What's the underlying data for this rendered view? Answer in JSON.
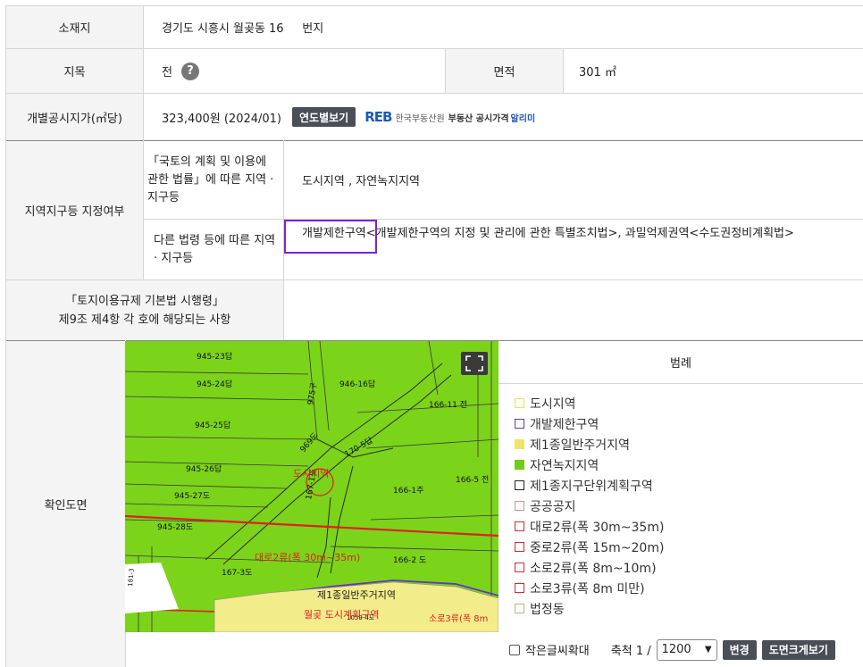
{
  "row_address": {
    "label": "소재지",
    "value": "경기도 시흥시 월곶동 16     번지"
  },
  "row_land": {
    "label": "지목",
    "value": "전",
    "area_label": "면적",
    "area_value": "301 ㎡"
  },
  "row_price": {
    "label": "개별공시지가(㎡당)",
    "value": "323,400원 (2024/01)",
    "button": "연도별보기",
    "reb_logo": "REB",
    "reb_name": "한국부동산원",
    "reb_service": "부동산 공시가격",
    "reb_alimi": "알리미"
  },
  "zone": {
    "label": "지역지구등 지정여부",
    "law1_label": "「국토의 계획 및 이용에 관한 법률」에 따른 지역 · 지구등",
    "law1_value": "도시지역 , 자연녹지지역",
    "law2_label": "다른 법령 등에 따른 지역 · 지구등",
    "law2_value": "개발제한구역<개발제한구역의 지정 및 관리에 관한 특별조치법>, 과밀억제권역<수도권정비계획법>"
  },
  "regulation": {
    "label_line1": "「토지이용규제 기본법 시행령」",
    "label_line2": "제9조 제4항 각 호에 해당되는 사항",
    "value": ""
  },
  "map_section": {
    "label": "확인도면",
    "parcels": [
      "945-23답",
      "945-24답",
      "946-16답",
      "945-25답",
      "975구",
      "166-11 전",
      "945-26답",
      "170-5답",
      "969도",
      "166-5 전",
      "945-27도",
      "166-1주",
      "945-28도",
      "167-1도",
      "167-3도",
      "166-2 도",
      "1059-4도",
      "181-3"
    ],
    "zone_labels": [
      "도시지역",
      "대로2류(폭 30m~35m)",
      "제1종일반주거지역",
      "월곶 도시계획구역",
      "소로3류(폭 8m"
    ],
    "fullscreen_icon": "expand-icon"
  },
  "legend": {
    "title": "범례",
    "items": [
      {
        "label": "도시지역",
        "color": "#f2e24a",
        "fill": false
      },
      {
        "label": "개발제한구역",
        "color": "#5b3aa6",
        "fill": false
      },
      {
        "label": "제1종일반주거지역",
        "color": "#efe36a",
        "fill": true
      },
      {
        "label": "자연녹지지역",
        "color": "#6ecc1c",
        "fill": true
      },
      {
        "label": "제1종지구단위계획구역",
        "color": "#222222",
        "fill": false
      },
      {
        "label": "공공공지",
        "color": "#c9968c",
        "fill": false
      },
      {
        "label": "대로2류(폭 30m~35m)",
        "color": "#d62a2a",
        "fill": false
      },
      {
        "label": "중로2류(폭 15m~20m)",
        "color": "#d62a2a",
        "fill": false
      },
      {
        "label": "소로2류(폭 8m~10m)",
        "color": "#d62a2a",
        "fill": false
      },
      {
        "label": "소로3류(폭 8m 미만)",
        "color": "#d62a2a",
        "fill": false
      },
      {
        "label": "법정동",
        "color": "#bdb47a",
        "fill": false
      }
    ]
  },
  "footer": {
    "small_text_label": "작은글씨확대",
    "scale_label": "축척 1 /",
    "scale_value": "1200",
    "change_button": "변경",
    "enlarge_button": "도면크게보기"
  }
}
